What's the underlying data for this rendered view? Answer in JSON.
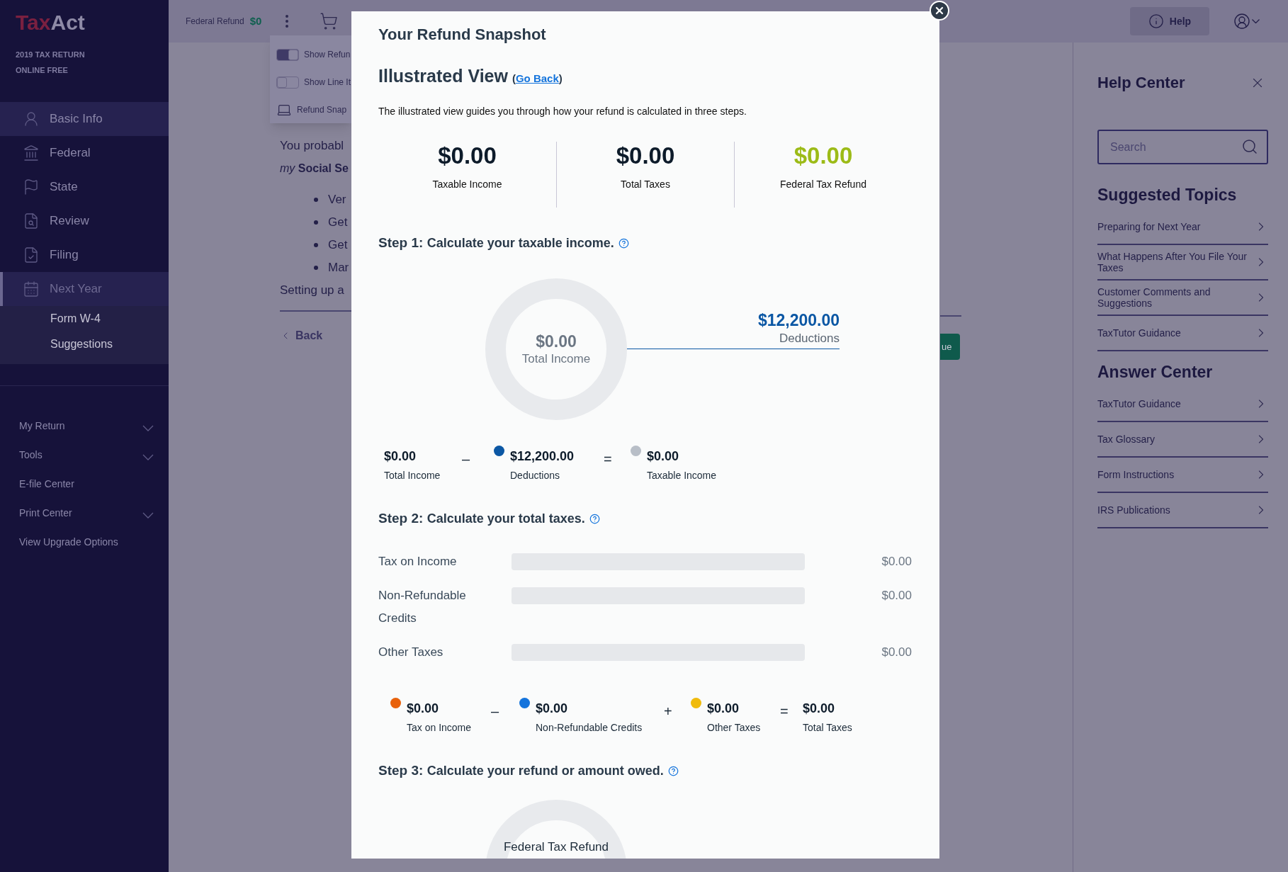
{
  "sidebar": {
    "logo": [
      "Tax",
      "Act"
    ],
    "return_lines": [
      "2019 TAX RETURN",
      "ONLINE FREE"
    ],
    "nav": [
      {
        "label": "Basic Info",
        "selected": false,
        "highlighted": true
      },
      {
        "label": "Federal",
        "selected": false,
        "highlighted": false
      },
      {
        "label": "State",
        "selected": false,
        "highlighted": false
      },
      {
        "label": "Review",
        "selected": false,
        "highlighted": false
      },
      {
        "label": "Filing",
        "selected": false,
        "highlighted": false
      },
      {
        "label": "Next Year",
        "selected": true,
        "highlighted": false,
        "children": [
          "Form W-4",
          "Suggestions"
        ]
      }
    ],
    "tools": [
      {
        "label": "My Return",
        "expandable": true
      },
      {
        "label": "Tools",
        "expandable": true
      },
      {
        "label": "E-file Center",
        "expandable": false
      },
      {
        "label": "Print Center",
        "expandable": true
      },
      {
        "label": "View Upgrade Options",
        "expandable": false
      }
    ]
  },
  "top_bar": {
    "refund_label": "Federal Refund",
    "refund_value": "$0",
    "help": "Help"
  },
  "menu": [
    {
      "kind": "toggle",
      "label": "Show Refun",
      "on": true
    },
    {
      "kind": "toggle",
      "label": "Show Line It",
      "on": false
    },
    {
      "kind": "link",
      "label": "Refund Snap"
    }
  ],
  "page": {
    "intro": "You probabl",
    "service": "*my* **Social Se**",
    "bullets": [
      "Ver",
      "Get",
      "Get",
      "Mar"
    ],
    "setup": "Setting up a",
    "back": "Back",
    "continue": "ue"
  },
  "modal": {
    "title": "Your Refund Snapshot",
    "view_title": "Illustrated View",
    "go_back": {
      "open": "(",
      "link": "Go Back",
      "close": ")"
    },
    "description": "The illustrated view guides you through how your refund is calculated in three steps.",
    "summary": [
      {
        "value": "$0.00",
        "label": "Taxable Income",
        "color": "#0d1b2a"
      },
      {
        "value": "$0.00",
        "label": "Total Taxes",
        "color": "#0d1b2a"
      },
      {
        "value": "$0.00",
        "label": "Federal Tax Refund",
        "color": "#9cbb17"
      }
    ],
    "step1": {
      "label": "Step 1:",
      "text": "Calculate your taxable income.",
      "center_value": "$0.00",
      "center_label": "Total Income",
      "deductions_value": "$12,200.00",
      "deductions_label": "Deductions",
      "equation": [
        {
          "kind": "term",
          "value": "$0.00",
          "label": "Total Income"
        },
        {
          "kind": "operator",
          "symbol": "–"
        },
        {
          "kind": "term",
          "value": "$12,200.00",
          "label": "Deductions",
          "color": "#0b57a4"
        },
        {
          "kind": "operator",
          "symbol": "="
        },
        {
          "kind": "term",
          "value": "$0.00",
          "label": "Taxable Income",
          "color": "#b8bec7"
        }
      ]
    },
    "step2": {
      "label": "Step 2:",
      "text": "Calculate your total taxes.",
      "bars": [
        {
          "label": "Tax on Income",
          "value": "$0.00",
          "level": 0
        },
        {
          "label": "Non-Refundable Credits",
          "value": "$0.00",
          "level": 0
        },
        {
          "label": "Other Taxes",
          "value": "$0.00",
          "level": 0
        }
      ],
      "equation": [
        {
          "kind": "term",
          "value": "$0.00",
          "label": "Tax on Income",
          "color": "#e8620c"
        },
        {
          "kind": "operator",
          "symbol": "–"
        },
        {
          "kind": "term",
          "value": "$0.00",
          "label": "Non-Refundable Credits",
          "color": "#1474dc"
        },
        {
          "kind": "operator",
          "symbol": "+"
        },
        {
          "kind": "term",
          "value": "$0.00",
          "label": "Other Taxes",
          "color": "#f0bb0c"
        },
        {
          "kind": "operator",
          "symbol": "="
        },
        {
          "kind": "term",
          "value": "$0.00",
          "label": "Total Taxes"
        }
      ]
    },
    "step3": {
      "label": "Step 3:",
      "text": "Calculate your refund or amount owed.",
      "center_label": "Federal Tax Refund"
    }
  },
  "help": {
    "title": "Help Center",
    "search": {
      "placeholder": "Search"
    },
    "sections": [
      {
        "title": "Suggested Topics",
        "items": [
          "Preparing for Next Year",
          "What Happens After You File Your Taxes",
          "Customer Comments and Suggestions",
          "TaxTutor Guidance"
        ]
      },
      {
        "title": "Answer Center",
        "items": [
          "TaxTutor Guidance",
          "Tax Glossary",
          "Form Instructions",
          "IRS Publications"
        ]
      }
    ]
  }
}
